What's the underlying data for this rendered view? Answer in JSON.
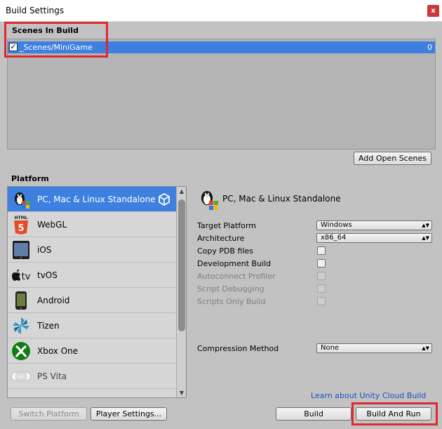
{
  "window": {
    "title": "Build Settings",
    "close_label": "x"
  },
  "scenes": {
    "header": "Scenes In Build",
    "items": [
      {
        "name": "_Scenes/MiniGame",
        "index": "0",
        "checked": true
      }
    ],
    "add_open_scenes_label": "Add Open Scenes"
  },
  "platform": {
    "header": "Platform",
    "items": [
      {
        "label": "PC, Mac & Linux Standalone",
        "icon": "penguin-windows-apple-icon",
        "selected": true
      },
      {
        "label": "WebGL",
        "icon": "html5-icon"
      },
      {
        "label": "iOS",
        "icon": "ipad-icon"
      },
      {
        "label": "tvOS",
        "icon": "apple-tv-icon"
      },
      {
        "label": "Android",
        "icon": "android-phone-icon"
      },
      {
        "label": "Tizen",
        "icon": "tizen-icon"
      },
      {
        "label": "Xbox One",
        "icon": "xbox-icon"
      },
      {
        "label": "PS Vita",
        "icon": "ps-vita-icon"
      }
    ]
  },
  "settings": {
    "header": "PC, Mac & Linux Standalone",
    "target_platform": {
      "label": "Target Platform",
      "value": "Windows"
    },
    "architecture": {
      "label": "Architecture",
      "value": "x86_64"
    },
    "copy_pdb": {
      "label": "Copy PDB files"
    },
    "development_build": {
      "label": "Development Build"
    },
    "autoconnect_profiler": {
      "label": "Autoconnect Profiler"
    },
    "script_debugging": {
      "label": "Script Debugging"
    },
    "scripts_only_build": {
      "label": "Scripts Only Build"
    },
    "compression": {
      "label": "Compression Method",
      "value": "None"
    }
  },
  "footer": {
    "cloud_link": "Learn about Unity Cloud Build",
    "switch_platform": "Switch Platform",
    "player_settings": "Player Settings...",
    "build": "Build",
    "build_and_run": "Build And Run"
  },
  "colors": {
    "selection": "#3d80df",
    "highlight_box": "#e0282e",
    "link": "#1c4fc4"
  }
}
